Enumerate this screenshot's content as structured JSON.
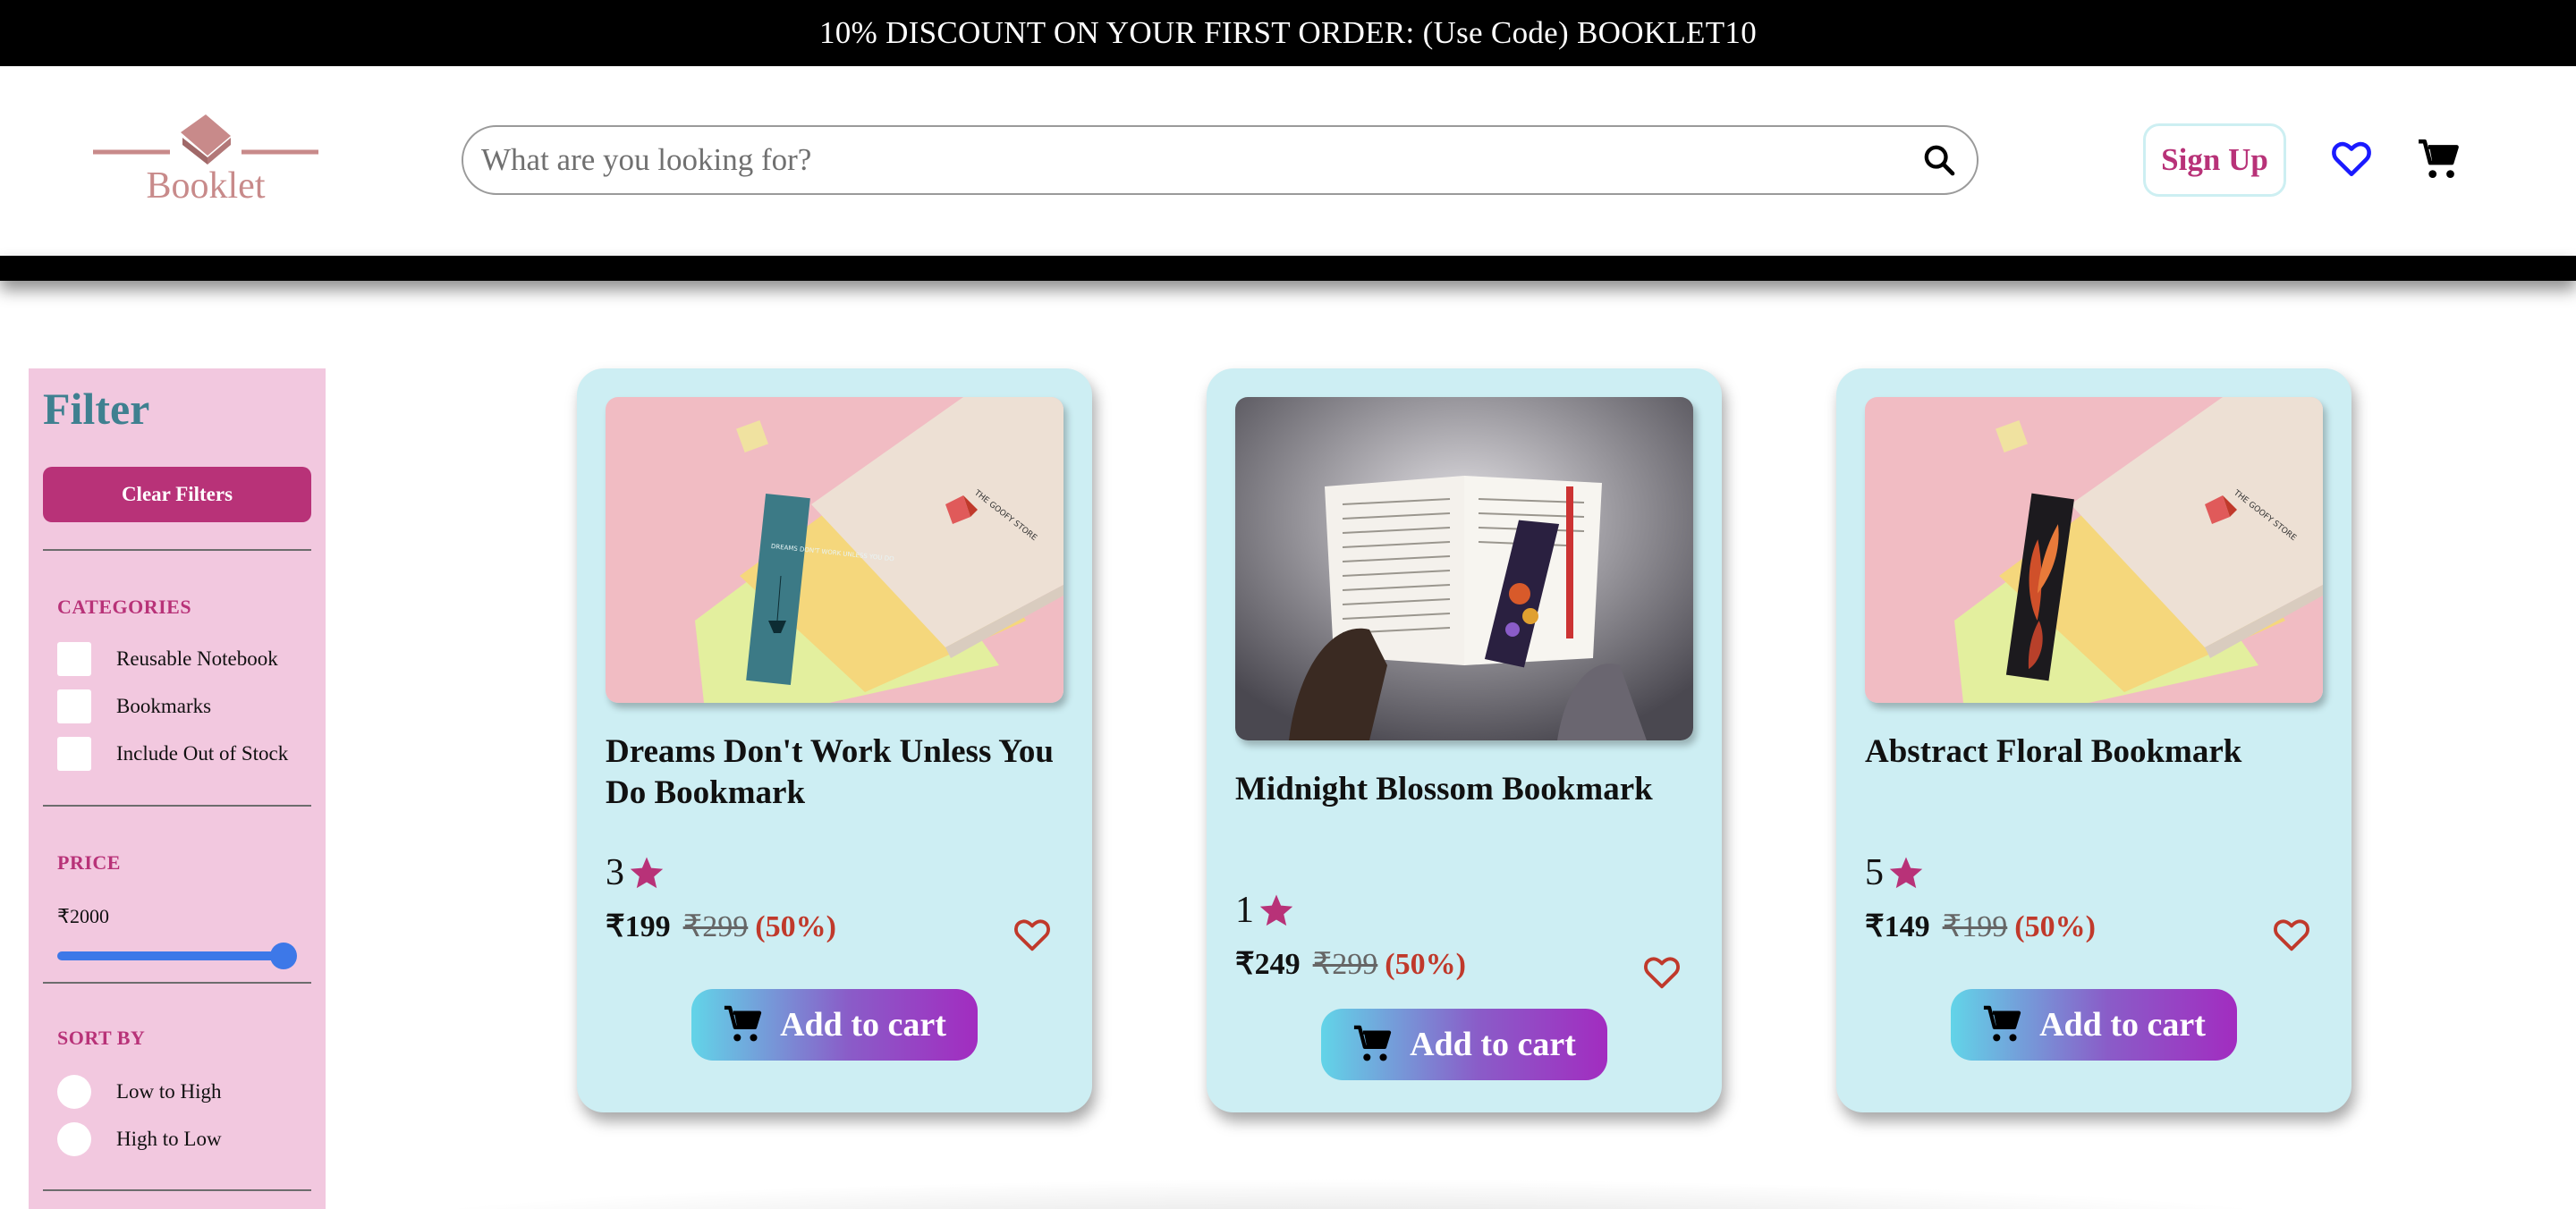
{
  "promo": {
    "text": "10% DISCOUNT ON YOUR FIRST ORDER: (Use Code) BOOKLET10"
  },
  "header": {
    "logo_text": "Booklet",
    "search_placeholder": "What are you looking for?",
    "signup_label": "Sign Up",
    "icons": [
      "search-icon",
      "heart-icon",
      "cart-icon"
    ]
  },
  "filter": {
    "title": "Filter",
    "clear_label": "Clear Filters",
    "categories": {
      "title": "CATEGORIES",
      "options": [
        "Reusable Notebook",
        "Bookmarks",
        "Include Out of Stock"
      ]
    },
    "price": {
      "title": "PRICE",
      "value": "₹2000",
      "slider_fraction": 1.0
    },
    "sort": {
      "title": "SORT BY",
      "options": [
        "Low to High",
        "High to Low"
      ]
    }
  },
  "products": [
    {
      "title": "Dreams Don't Work Unless You Do Bookmark",
      "rating": "3",
      "price": "₹199",
      "original_price": "₹299",
      "discount": "(50%)",
      "button": "Add to cart",
      "bookmark_text": "DREAMS DON'T WORK UNLESS YOU DO",
      "brand_text": "THE GOOFY STORE"
    },
    {
      "title": "Midnight Blossom Bookmark",
      "rating": "1",
      "price": "₹249",
      "original_price": "₹299",
      "discount": "(50%)",
      "button": "Add to cart"
    },
    {
      "title": "Abstract Floral Bookmark",
      "rating": "5",
      "price": "₹149",
      "original_price": "₹199",
      "discount": "(50%)",
      "button": "Add to cart",
      "brand_text": "THE GOOFY STORE"
    }
  ],
  "colors": {
    "accent": "#b83278",
    "card_bg": "#cdeef3",
    "filter_bg": "#f2c8df",
    "filter_title": "#3f8090",
    "discount_red": "#c0392b",
    "wishlist_blue": "#1a1aff"
  }
}
